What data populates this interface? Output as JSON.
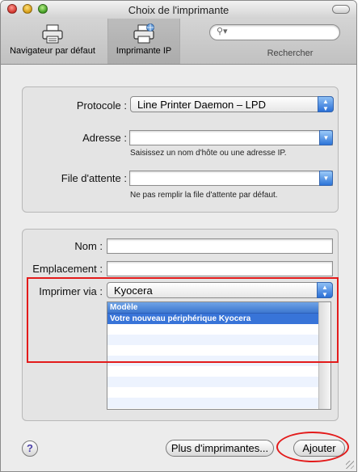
{
  "window": {
    "title": "Choix de l'imprimante"
  },
  "toolbar": {
    "default_label": "Navigateur par défaut",
    "ip_label": "Imprimante IP",
    "search_label": "Rechercher",
    "search_placeholder": ""
  },
  "form": {
    "protocol_label": "Protocole :",
    "protocol_value": "Line Printer Daemon – LPD",
    "address_label": "Adresse :",
    "address_value": "",
    "address_hint": "Saisissez un nom d'hôte ou une adresse IP.",
    "queue_label": "File d'attente :",
    "queue_value": "",
    "queue_hint": "Ne pas remplir la file d'attente par défaut.",
    "name_label": "Nom :",
    "name_value": "",
    "location_label": "Emplacement :",
    "location_value": "",
    "print_using_label": "Imprimer via :",
    "print_using_value": "Kyocera",
    "model_list": {
      "header": "Modèle",
      "items": [
        "Votre nouveau périphérique Kyocera"
      ]
    }
  },
  "buttons": {
    "help": "?",
    "more_printers": "Plus d'imprimantes...",
    "add": "Ajouter"
  },
  "colors": {
    "annotation": "#e31b1b",
    "selection": "#3874d8"
  }
}
